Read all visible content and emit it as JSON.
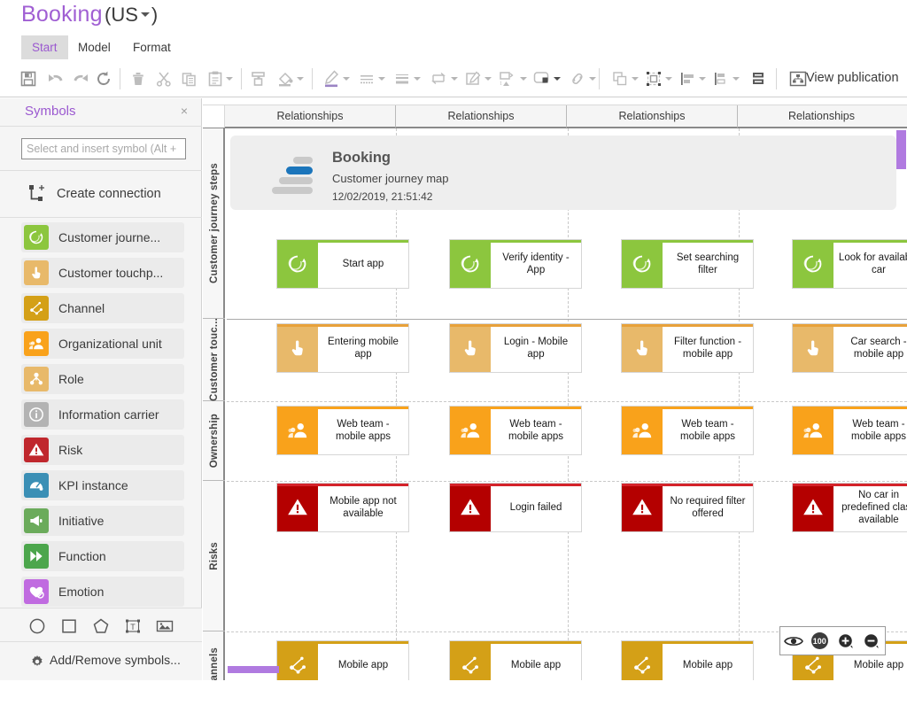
{
  "titlebar": {
    "model_name": "Booking",
    "locale_open": "(",
    "locale": "US",
    "locale_close": ")"
  },
  "menu": {
    "tabs": [
      {
        "label": "Start",
        "active": true
      },
      {
        "label": "Model",
        "active": false
      },
      {
        "label": "Format",
        "active": false
      }
    ],
    "top_icons": [
      {
        "name": "search-icon",
        "selected": false
      },
      {
        "name": "info-icon",
        "selected": false
      },
      {
        "name": "chart-icon",
        "selected": false
      },
      {
        "name": "shield-icon",
        "selected": false
      },
      {
        "name": "diagram-icon",
        "selected": true
      },
      {
        "name": "comments-icon",
        "selected": false
      }
    ]
  },
  "toolbar": {
    "view_publication_label": "View publication",
    "buttons": [
      "save-button",
      "undo-button",
      "redo-button",
      "refresh-button",
      "delete-button",
      "cut-button",
      "copy-button",
      "paste-button",
      "format-painter-button",
      "fill-color-button",
      "pen-color-button",
      "line-style-button",
      "line-weight-button",
      "connector-button",
      "edit-shape-button",
      "insert-object-button",
      "shape-style-button",
      "link-button",
      "group-button",
      "size-button",
      "align-button",
      "distribute-button",
      "order-button"
    ]
  },
  "sidebar": {
    "title": "Symbols",
    "close_label": "×",
    "search_placeholder": "Select and insert symbol (Alt +",
    "search_value": "",
    "create_connection_label": "Create connection",
    "items": [
      {
        "label": "Customer journe...",
        "color": "#8cc63e",
        "icon": "customer-journey-step-icon"
      },
      {
        "label": "Customer touchp...",
        "color": "#e8b96a",
        "icon": "customer-touchpoint-icon"
      },
      {
        "label": "Channel",
        "color": "#d4a017",
        "icon": "channel-icon"
      },
      {
        "label": "Organizational unit",
        "color": "#f9a21b",
        "icon": "organizational-unit-icon"
      },
      {
        "label": "Role",
        "color": "#e8b96a",
        "icon": "role-icon"
      },
      {
        "label": "Information carrier",
        "color": "#b3b3b3",
        "icon": "information-carrier-icon"
      },
      {
        "label": "Risk",
        "color": "#c0272d",
        "icon": "risk-icon"
      },
      {
        "label": "KPI instance",
        "color": "#3b8fb5",
        "icon": "kpi-instance-icon"
      },
      {
        "label": "Initiative",
        "color": "#6bab5b",
        "icon": "initiative-icon"
      },
      {
        "label": "Function",
        "color": "#4ca64c",
        "icon": "function-icon"
      },
      {
        "label": "Emotion",
        "color": "#c06be0",
        "icon": "emotion-icon"
      }
    ],
    "shape_tools": [
      {
        "name": "circle-tool"
      },
      {
        "name": "rectangle-tool"
      },
      {
        "name": "pentagon-tool"
      },
      {
        "name": "textbox-tool"
      },
      {
        "name": "image-tool"
      }
    ],
    "add_remove_label": "Add/Remove symbols..."
  },
  "canvas": {
    "column_headers": [
      "Relationships",
      "Relationships",
      "Relationships",
      "Relationships"
    ],
    "row_headers": [
      "Customer journey steps",
      "Customer touc...",
      "Ownership",
      "Risks",
      "Channels"
    ],
    "header_card": {
      "name": "Booking",
      "type": "Customer journey map",
      "date": "12/02/2019, 21:51:42"
    },
    "rows": [
      {
        "row": "Customer journey steps",
        "icon": "customer-journey-step-icon",
        "icon_color": "#8cc63e",
        "top_border": "#8cc63e",
        "cards": [
          "Start app",
          "Verify identity - App",
          "Set searching filter",
          "Look for available car"
        ]
      },
      {
        "row": "Customer touc...",
        "icon": "customer-touchpoint-icon",
        "icon_color": "#e8b96a",
        "top_border": "#e8a13a",
        "cards": [
          "Entering mobile app",
          "Login - Mobile app",
          "Filter function - mobile app",
          "Car search - mobile app"
        ]
      },
      {
        "row": "Ownership",
        "icon": "organizational-unit-icon",
        "icon_color": "#f9a21b",
        "top_border": "#f9a21b",
        "cards": [
          "Web team - mobile apps",
          "Web team - mobile apps",
          "Web team - mobile apps",
          "Web team - mobile apps"
        ]
      },
      {
        "row": "Risks",
        "icon": "risk-icon",
        "icon_color": "#b40000",
        "top_border": "#d4232a",
        "cards": [
          "Mobile app not available",
          "Login failed",
          "No required filter offered",
          "No car in predefined class available"
        ]
      },
      {
        "row": "Channels",
        "icon": "channel-icon",
        "icon_color": "#d4a017",
        "top_border": "#d4a017",
        "cards": [
          "Mobile app",
          "Mobile app",
          "Mobile app",
          "Mobile app"
        ]
      }
    ]
  },
  "zoombar": {
    "buttons": [
      {
        "name": "fit-view-button",
        "label": ""
      },
      {
        "name": "zoom-100-button",
        "label": "100"
      },
      {
        "name": "zoom-in-button",
        "label": ""
      },
      {
        "name": "zoom-out-button",
        "label": ""
      }
    ],
    "zoom_level": "100"
  }
}
